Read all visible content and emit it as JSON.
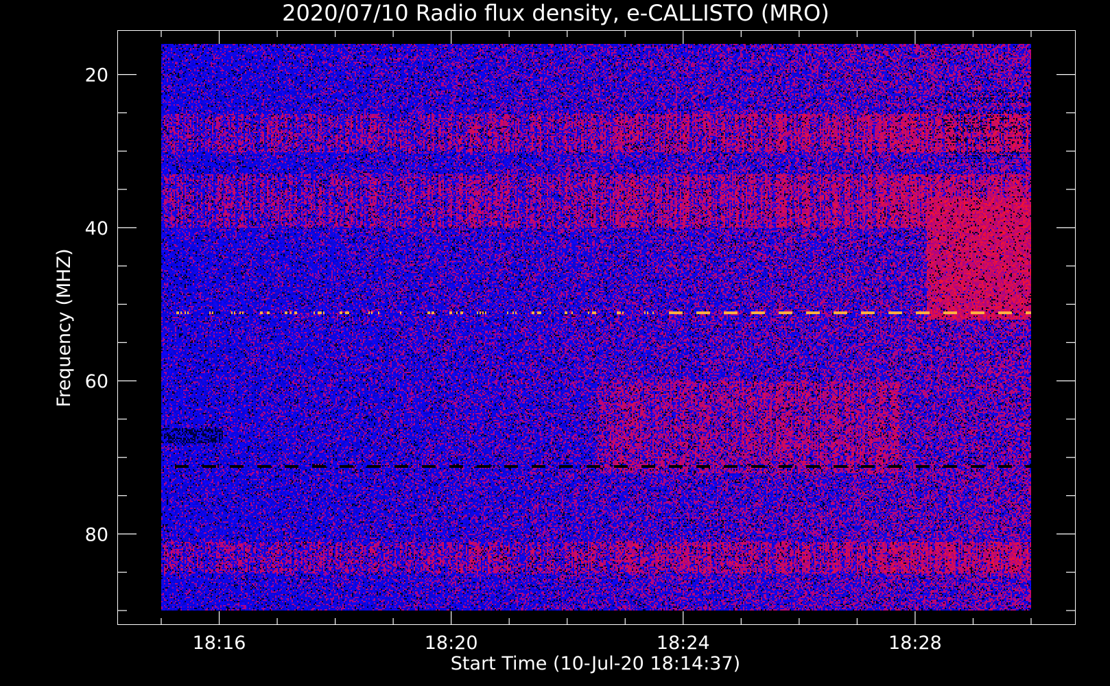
{
  "chart_data": {
    "type": "heatmap",
    "title": "2020/07/10  Radio flux density, e-CALLISTO (MRO)",
    "xlabel": "Start Time (10-Jul-20 18:14:37)",
    "ylabel": "Frequency (MHZ)",
    "x_ticks": [
      {
        "label": "18:16",
        "minutes": 16
      },
      {
        "label": "18:20",
        "minutes": 20
      },
      {
        "label": "18:24",
        "minutes": 24
      },
      {
        "label": "18:28",
        "minutes": 28
      }
    ],
    "x_range_minutes": [
      15,
      30
    ],
    "x_minor_step_minutes": 1,
    "y_ticks": [
      20,
      40,
      60,
      80
    ],
    "y_range_mhz": [
      16,
      90
    ],
    "y_minor_step_mhz": 5,
    "y_inverted": true,
    "colormap": [
      "#000000",
      "#1010e6",
      "#b01818",
      "#ff5a1e",
      "#ffd070"
    ],
    "features": [
      {
        "name": "narrowband interference",
        "freq_mhz": 51,
        "color": "#ffb040"
      },
      {
        "name": "narrowband interference",
        "freq_mhz": 71,
        "color": "#000000"
      },
      {
        "name": "red emission band",
        "freq_mhz_range": [
          25,
          30
        ]
      },
      {
        "name": "red emission band",
        "freq_mhz_range": [
          33,
          40
        ]
      },
      {
        "name": "red emission band",
        "freq_mhz_range": [
          81,
          85
        ]
      }
    ]
  }
}
